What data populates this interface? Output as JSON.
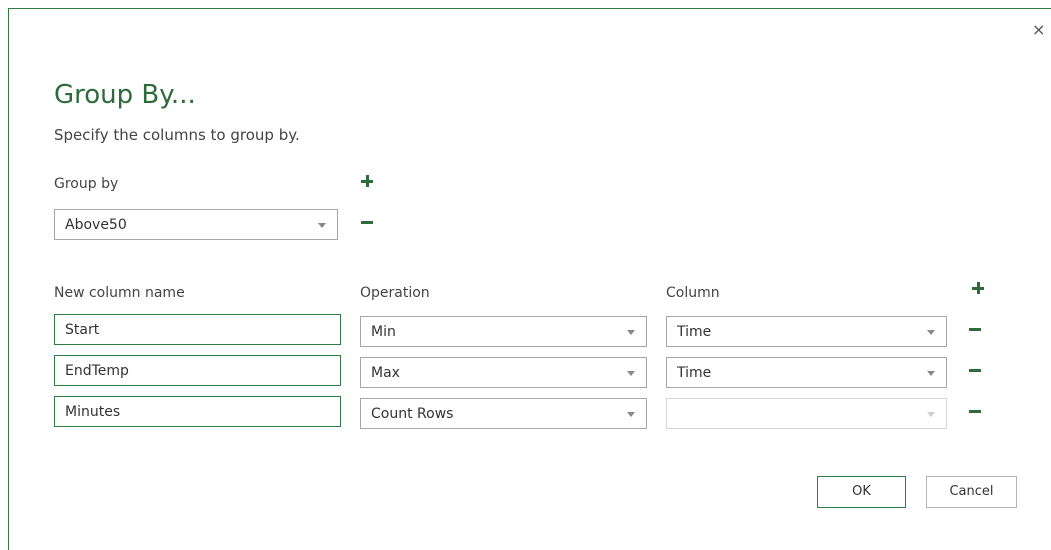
{
  "dialog": {
    "title": "Group By...",
    "subtitle": "Specify the columns to group by.",
    "close_symbol": "×"
  },
  "group_by": {
    "label": "Group by",
    "selected": "Above50"
  },
  "aggregations": {
    "headers": {
      "new_column_name": "New column name",
      "operation": "Operation",
      "column": "Column"
    },
    "rows": [
      {
        "name": "Start",
        "operation": "Min",
        "column": "Time"
      },
      {
        "name": "EndTemp",
        "operation": "Max",
        "column": "Time"
      },
      {
        "name": "Minutes",
        "operation": "Count Rows",
        "column": ""
      }
    ]
  },
  "buttons": {
    "ok": "OK",
    "cancel": "Cancel"
  },
  "icons": {
    "add": "plus-icon",
    "remove": "minus-icon",
    "dropdown": "chevron-down-icon"
  },
  "colors": {
    "accent": "#2e6b3c",
    "border_active": "#2f7d45"
  }
}
